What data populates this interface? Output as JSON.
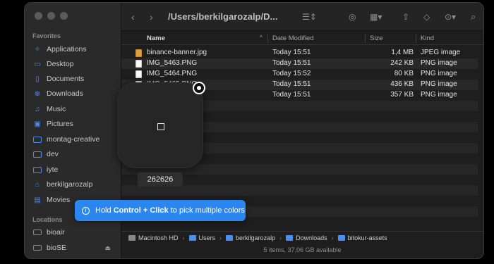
{
  "toolbar": {
    "path_title": "/Users/berkilgarozalp/D...",
    "back_icon": "chevron-left-icon",
    "forward_icon": "chevron-right-icon"
  },
  "sidebar": {
    "favorites_label": "Favorites",
    "favorites": [
      {
        "label": "Applications",
        "icon": "applications-icon"
      },
      {
        "label": "Desktop",
        "icon": "desktop-icon"
      },
      {
        "label": "Documents",
        "icon": "documents-icon"
      },
      {
        "label": "Downloads",
        "icon": "downloads-icon"
      },
      {
        "label": "Music",
        "icon": "music-icon"
      },
      {
        "label": "Pictures",
        "icon": "pictures-icon"
      },
      {
        "label": "montag-creative",
        "icon": "folder-icon"
      },
      {
        "label": "dev",
        "icon": "folder-icon"
      },
      {
        "label": "iyte",
        "icon": "folder-icon"
      },
      {
        "label": "berkilgarozalp",
        "icon": "home-icon"
      },
      {
        "label": "Movies",
        "icon": "movies-icon"
      }
    ],
    "locations_label": "Locations",
    "locations": [
      {
        "label": "bioair",
        "icon": "laptop-icon"
      },
      {
        "label": "bioSE",
        "icon": "disk-icon"
      }
    ]
  },
  "columns": {
    "name": "Name",
    "date": "Date Modified",
    "size": "Size",
    "kind": "Kind"
  },
  "files": [
    {
      "name": "binance-banner.jpg",
      "date": "Today 15:51",
      "size": "1,4 MB",
      "kind": "JPEG image"
    },
    {
      "name": "IMG_5463.PNG",
      "date": "Today 15:51",
      "size": "242 KB",
      "kind": "PNG image"
    },
    {
      "name": "IMG_5464.PNG",
      "date": "Today 15:52",
      "size": "80 KB",
      "kind": "PNG image"
    },
    {
      "name": "IMG_5465.PNG",
      "date": "Today 15:51",
      "size": "436 KB",
      "kind": "PNG image"
    },
    {
      "name": "",
      "date": "Today 15:51",
      "size": "357 KB",
      "kind": "PNG image"
    }
  ],
  "pathbar": [
    "Macintosh HD",
    "Users",
    "berkilgarozalp",
    "Downloads",
    "bitokur-assets"
  ],
  "status": "5 items, 37,06 GB available",
  "picker": {
    "hex": "262626",
    "color": "#262626"
  },
  "tooltip": {
    "prefix": "Hold",
    "key1": "Control",
    "plus": "+",
    "key2": "Click",
    "suffix": "to pick multiple colors"
  }
}
